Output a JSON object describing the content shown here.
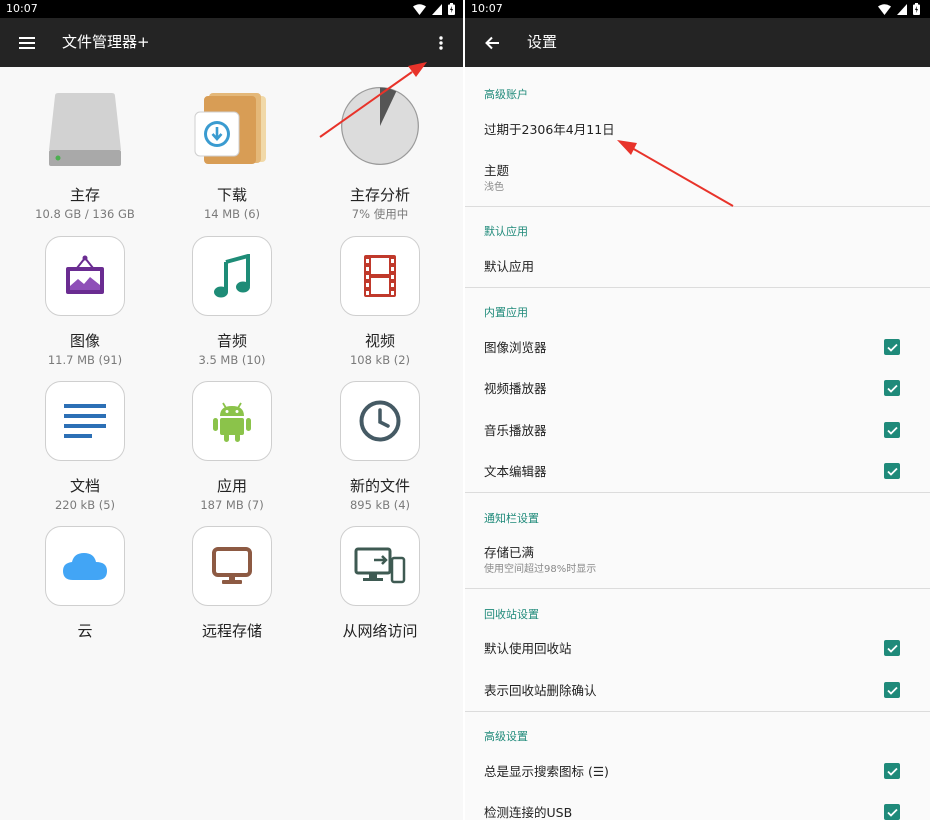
{
  "status_bar": {
    "time": "10:07"
  },
  "file_manager": {
    "title": "文件管理器+",
    "tiles": [
      {
        "name": "主存",
        "sub": "10.8 GB / 136 GB",
        "icon": "hard-drive-icon"
      },
      {
        "name": "下载",
        "sub": "14 MB (6)",
        "icon": "download-folder-icon"
      },
      {
        "name": "主存分析",
        "sub": "7% 使用中",
        "icon": "pie-chart-icon",
        "usage_fraction": 0.07
      },
      {
        "name": "图像",
        "sub": "11.7 MB (91)",
        "icon": "picture-frame-icon"
      },
      {
        "name": "音频",
        "sub": "3.5 MB (10)",
        "icon": "music-note-icon"
      },
      {
        "name": "视频",
        "sub": "108 kB (2)",
        "icon": "film-strip-icon"
      },
      {
        "name": "文档",
        "sub": "220 kB (5)",
        "icon": "document-lines-icon"
      },
      {
        "name": "应用",
        "sub": "187 MB (7)",
        "icon": "android-icon"
      },
      {
        "name": "新的文件",
        "sub": "895 kB (4)",
        "icon": "clock-icon"
      },
      {
        "name": "云",
        "sub": "",
        "icon": "cloud-icon"
      },
      {
        "name": "远程存储",
        "sub": "",
        "icon": "monitor-icon"
      },
      {
        "name": "从网络访问",
        "sub": "",
        "icon": "network-devices-icon"
      }
    ]
  },
  "settings": {
    "title": "设置",
    "sections": {
      "premium": {
        "header": "高级账户",
        "expiry": "过期于2306年4月11日",
        "theme_title": "主题",
        "theme_value": "浅色"
      },
      "default_app": {
        "header": "默认应用",
        "item": "默认应用"
      },
      "builtin": {
        "header": "内置应用",
        "items": [
          "图像浏览器",
          "视频播放器",
          "音乐播放器",
          "文本编辑器"
        ]
      },
      "notification": {
        "header": "通知栏设置",
        "title": "存储已满",
        "sub": "使用空间超过98%时显示"
      },
      "recycle": {
        "header": "回收站设置",
        "items": [
          "默认使用回收站",
          "表示回收站删除确认"
        ]
      },
      "advanced": {
        "header": "高级设置",
        "items": [
          "总是显示搜索图标 (☰)",
          "检测连接的USB"
        ]
      }
    }
  },
  "colors": {
    "accent": "#1f8a7a",
    "appbar": "#242424",
    "annotation": "#e8332a"
  }
}
